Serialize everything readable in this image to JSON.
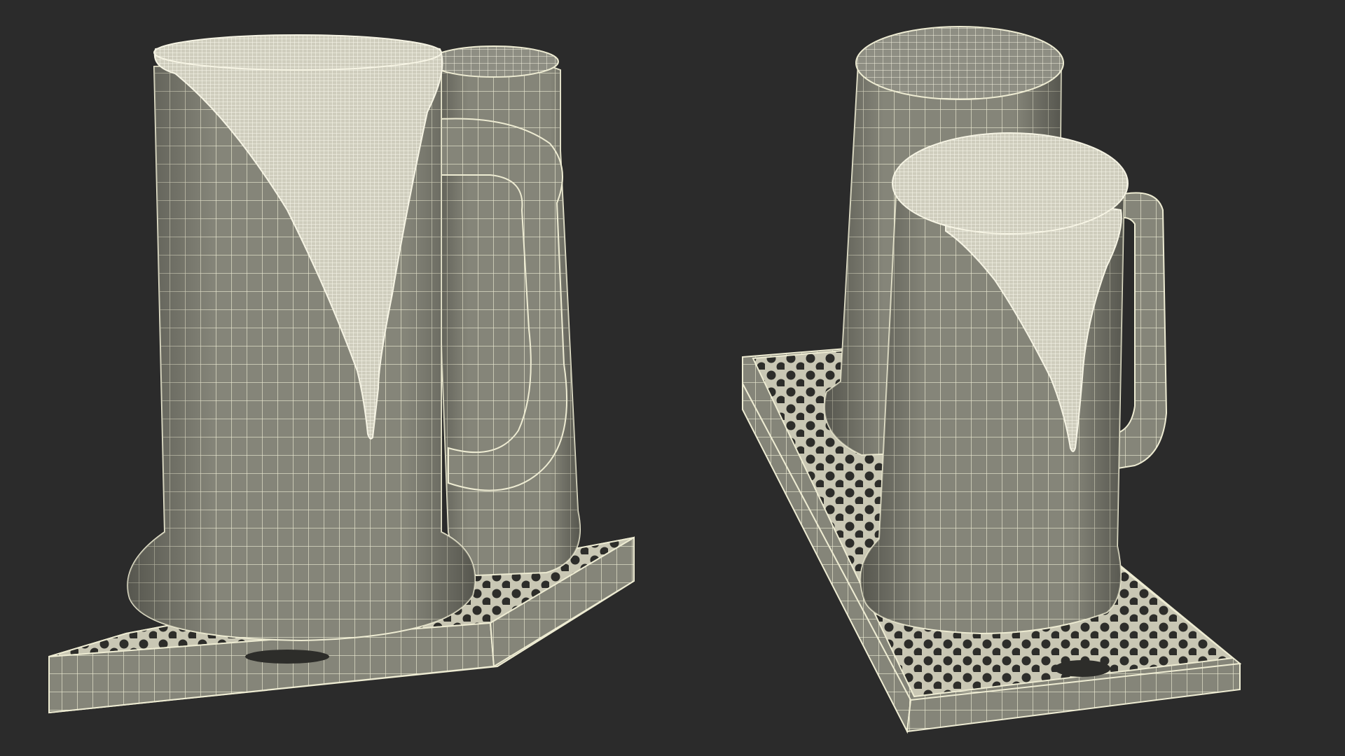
{
  "scene": {
    "background": "#2b2b2b",
    "mesh_fill": "#858579",
    "mesh_fill_dark": "#6e6e63",
    "wire_color": "#f1efd8",
    "foam_color": "#f4f2e2",
    "objects": [
      {
        "name": "left-view",
        "items": [
          "beer-mug-front",
          "beer-mug-back",
          "drip-tray"
        ]
      },
      {
        "name": "right-view",
        "items": [
          "beer-mug-front",
          "beer-mug-back",
          "drip-tray"
        ]
      }
    ]
  }
}
